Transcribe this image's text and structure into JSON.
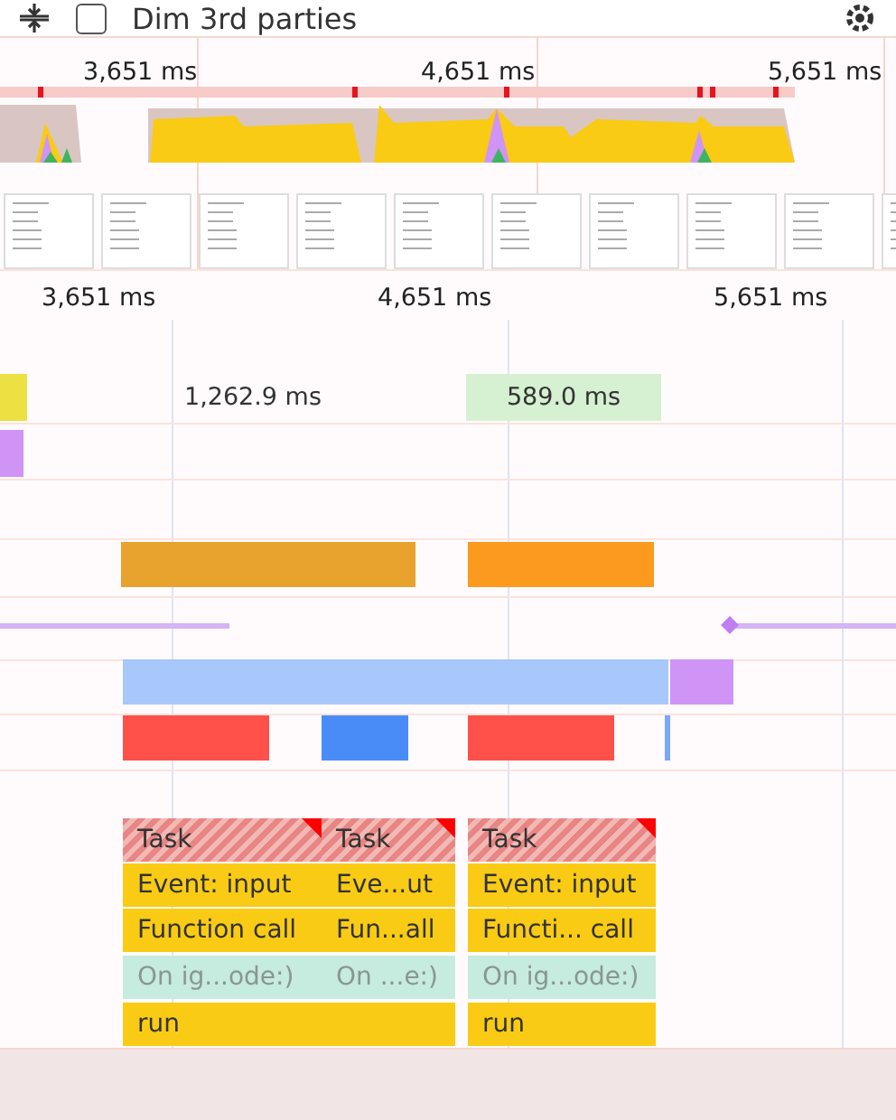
{
  "toolbar": {
    "dim_3rd_parties": {
      "label": "Dim 3rd parties",
      "checked": false
    }
  },
  "overview": {
    "ticks": [
      "3,651 ms",
      "4,651 ms",
      "5,651 ms"
    ]
  },
  "timeline": {
    "ticks": [
      "3,651 ms",
      "4,651 ms",
      "5,651 ms"
    ],
    "durations": [
      {
        "kind": "plain",
        "label": "1,262.9 ms"
      },
      {
        "kind": "highlight",
        "label": "589.0 ms"
      }
    ],
    "flame": [
      {
        "cells": [
          {
            "kind": "task",
            "label": "Task"
          },
          {
            "kind": "event",
            "label": "Event: input"
          },
          {
            "kind": "event",
            "label": "Function call"
          },
          {
            "kind": "callback",
            "label": "On ig...ode:)"
          },
          {
            "kind": "event",
            "label": "run"
          }
        ]
      },
      {
        "cells": [
          {
            "kind": "task",
            "label": "Task"
          },
          {
            "kind": "event",
            "label": "Eve...ut"
          },
          {
            "kind": "event",
            "label": "Fun...all"
          },
          {
            "kind": "callback",
            "label": "On ...e:)"
          },
          {
            "kind": "event"
          }
        ]
      },
      {
        "cells": [
          {
            "kind": "task",
            "label": "Task"
          },
          {
            "kind": "event",
            "label": "Event: input"
          },
          {
            "kind": "event",
            "label": "Functi... call"
          },
          {
            "kind": "callback",
            "label": "On ig...ode:)"
          },
          {
            "kind": "event",
            "label": "run"
          }
        ]
      }
    ]
  }
}
